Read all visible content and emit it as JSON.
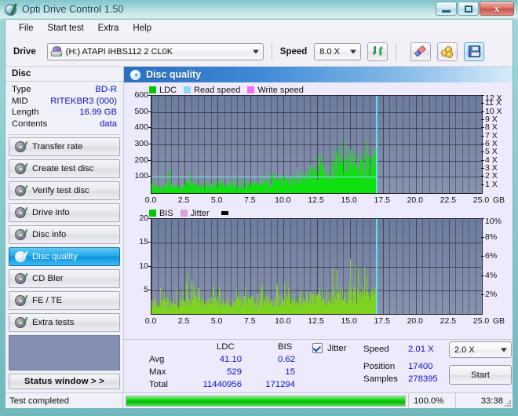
{
  "window": {
    "title": "Opti Drive Control 1.50",
    "icon": "disc-icon",
    "minimize_label": "Minimize",
    "maximize_label": "Maximize",
    "close_label": "Close"
  },
  "menu": {
    "items": [
      "File",
      "Start test",
      "Extra",
      "Help"
    ]
  },
  "toolbar": {
    "drive_label": "Drive",
    "drive_value": "(H:)  ATAPI iHBS112  2 CL0K",
    "drive_icon": "optical-drive-icon",
    "speed_label": "Speed",
    "speed_value": "8.0 X",
    "refresh_icon": "refresh-arrows-icon",
    "erase_icon": "eraser-icon",
    "coins_icon": "coins-icon",
    "save_icon": "save-disk-icon"
  },
  "sidebar": {
    "disc_header": "Disc",
    "disc_info": [
      {
        "key": "Type",
        "value": "BD-R"
      },
      {
        "key": "MID",
        "value": "RITEKBR3 (000)"
      },
      {
        "key": "Length",
        "value": "16.99 GB"
      },
      {
        "key": "Contents",
        "value": "data"
      }
    ],
    "nav": [
      {
        "label": "Transfer rate",
        "icon": "disc-test-icon",
        "selected": false
      },
      {
        "label": "Create test disc",
        "icon": "disc-test-icon",
        "selected": false
      },
      {
        "label": "Verify test disc",
        "icon": "disc-test-icon",
        "selected": false
      },
      {
        "label": "Drive info",
        "icon": "disc-test-icon",
        "selected": false
      },
      {
        "label": "Disc info",
        "icon": "disc-test-icon",
        "selected": false
      },
      {
        "label": "Disc quality",
        "icon": "disc-test-icon",
        "selected": true
      },
      {
        "label": "CD Bler",
        "icon": "disc-test-icon",
        "selected": false
      },
      {
        "label": "FE / TE",
        "icon": "disc-test-icon",
        "selected": false
      },
      {
        "label": "Extra tests",
        "icon": "disc-test-icon",
        "selected": false
      }
    ],
    "status_window_button": "Status window > >"
  },
  "panel": {
    "title": "Disc quality",
    "icon": "disc-quality-icon"
  },
  "chart_data": [
    {
      "type": "area",
      "name": "ldc-chart",
      "title": "",
      "xlabel": "GB",
      "ylabel": "",
      "legend": [
        {
          "label": "LDC",
          "color": "#00c800"
        },
        {
          "label": "Read speed",
          "color": "#8fd8f4"
        },
        {
          "label": "Write speed",
          "color": "#f26ef2"
        }
      ],
      "legend_position": "top-left",
      "grid": true,
      "xlim": [
        0,
        25
      ],
      "xticks": [
        0.0,
        2.5,
        5.0,
        7.5,
        10.0,
        12.5,
        15.0,
        17.5,
        20.0,
        22.5,
        25.0
      ],
      "xtick_labels": [
        "0.0",
        "2.5",
        "5.0",
        "7.5",
        "10.0",
        "12.5",
        "15.0",
        "17.5",
        "20.0",
        "22.5",
        "25.0"
      ],
      "x_unit": "GB",
      "ylim": [
        0,
        600
      ],
      "yticks": [
        100,
        200,
        300,
        400,
        500,
        600
      ],
      "ytick_labels": [
        "100",
        "200",
        "300",
        "400",
        "500",
        "600"
      ],
      "y2lim": [
        0,
        12
      ],
      "y2ticks": [
        1,
        2,
        3,
        4,
        5,
        6,
        7,
        8,
        9,
        10,
        11,
        12
      ],
      "y2tick_labels": [
        "1 X",
        "2 X",
        "3 X",
        "4 X",
        "5 X",
        "6 X",
        "7 X",
        "8 X",
        "9 X",
        "10 X",
        "11 X",
        "12 X"
      ],
      "data_end_x": 17.0,
      "read_speed_level": 2.0,
      "series": [
        {
          "name": "LDC",
          "color": "#0fe00f",
          "x_start": 0,
          "x_end": 17.0,
          "envelope": [
            {
              "x": 0.0,
              "base": 60,
              "peak": 95
            },
            {
              "x": 0.5,
              "base": 58,
              "peak": 100
            },
            {
              "x": 1.0,
              "base": 58,
              "peak": 95
            },
            {
              "x": 1.35,
              "base": 60,
              "peak": 160
            },
            {
              "x": 1.8,
              "base": 57,
              "peak": 92
            },
            {
              "x": 2.4,
              "base": 58,
              "peak": 96
            },
            {
              "x": 2.75,
              "base": 85,
              "peak": 530
            },
            {
              "x": 2.95,
              "base": 70,
              "peak": 205
            },
            {
              "x": 3.3,
              "base": 58,
              "peak": 95
            },
            {
              "x": 4.0,
              "base": 58,
              "peak": 92
            },
            {
              "x": 5.0,
              "base": 58,
              "peak": 95
            },
            {
              "x": 6.0,
              "base": 60,
              "peak": 98
            },
            {
              "x": 7.0,
              "base": 62,
              "peak": 100
            },
            {
              "x": 8.0,
              "base": 70,
              "peak": 108
            },
            {
              "x": 9.0,
              "base": 85,
              "peak": 125
            },
            {
              "x": 10.0,
              "base": 105,
              "peak": 155
            },
            {
              "x": 11.0,
              "base": 120,
              "peak": 175
            },
            {
              "x": 12.0,
              "base": 145,
              "peak": 200
            },
            {
              "x": 12.6,
              "base": 165,
              "peak": 235
            },
            {
              "x": 13.2,
              "base": 200,
              "peak": 270
            },
            {
              "x": 14.0,
              "base": 230,
              "peak": 300
            },
            {
              "x": 14.6,
              "base": 250,
              "peak": 330
            },
            {
              "x": 15.2,
              "base": 255,
              "peak": 345
            },
            {
              "x": 16.0,
              "base": 250,
              "peak": 330
            },
            {
              "x": 16.6,
              "base": 250,
              "peak": 320
            },
            {
              "x": 17.0,
              "base": 255,
              "peak": 350
            }
          ]
        },
        {
          "name": "Read speed",
          "color": "#74e8f0",
          "type": "line",
          "value_x": 2.0,
          "x_start": 0,
          "x_end": 17.0
        }
      ]
    },
    {
      "type": "area",
      "name": "bis-chart",
      "title": "",
      "xlabel": "GB",
      "legend": [
        {
          "label": "BIS",
          "color": "#00c800"
        },
        {
          "label": "Jitter",
          "color": "#dda0dd"
        }
      ],
      "legend_position": "top-left",
      "grid": true,
      "xlim": [
        0,
        25
      ],
      "xticks": [
        0.0,
        2.5,
        5.0,
        7.5,
        10.0,
        12.5,
        15.0,
        17.5,
        20.0,
        22.5,
        25.0
      ],
      "xtick_labels": [
        "0.0",
        "2.5",
        "5.0",
        "7.5",
        "10.0",
        "12.5",
        "15.0",
        "17.5",
        "20.0",
        "22.5",
        "25.0"
      ],
      "x_unit": "GB",
      "ylim": [
        0,
        20
      ],
      "yticks": [
        5,
        10,
        15,
        20
      ],
      "ytick_labels": [
        "5",
        "10",
        "15",
        "20"
      ],
      "y2lim": [
        0,
        10
      ],
      "y2ticks": [
        2,
        4,
        6,
        8,
        10
      ],
      "y2tick_labels": [
        "2%",
        "4%",
        "6%",
        "8%",
        "10%"
      ],
      "data_end_x": 17.0,
      "series": [
        {
          "name": "BIS",
          "color": "#7ed321",
          "x_start": 0,
          "x_end": 17.0,
          "envelope": [
            {
              "x": 0.0,
              "base": 3.3,
              "peak": 4.8
            },
            {
              "x": 0.6,
              "base": 3.4,
              "peak": 5.4
            },
            {
              "x": 1.2,
              "base": 3.4,
              "peak": 5.8
            },
            {
              "x": 1.8,
              "base": 3.3,
              "peak": 5.3
            },
            {
              "x": 2.4,
              "base": 3.4,
              "peak": 5.6
            },
            {
              "x": 2.75,
              "base": 4.2,
              "peak": 11.0
            },
            {
              "x": 3.1,
              "base": 3.5,
              "peak": 6.0
            },
            {
              "x": 4.0,
              "base": 3.4,
              "peak": 5.5
            },
            {
              "x": 5.0,
              "base": 3.5,
              "peak": 6.2
            },
            {
              "x": 6.0,
              "base": 3.6,
              "peak": 6.0
            },
            {
              "x": 7.0,
              "base": 3.8,
              "peak": 6.4
            },
            {
              "x": 8.0,
              "base": 3.9,
              "peak": 6.3
            },
            {
              "x": 9.0,
              "base": 4.0,
              "peak": 6.8
            },
            {
              "x": 10.0,
              "base": 4.2,
              "peak": 7.2
            },
            {
              "x": 10.8,
              "base": 4.3,
              "peak": 7.6
            },
            {
              "x": 11.8,
              "base": 4.6,
              "peak": 13.0
            },
            {
              "x": 12.4,
              "base": 4.8,
              "peak": 8.0
            },
            {
              "x": 13.0,
              "base": 5.4,
              "peak": 9.8
            },
            {
              "x": 13.8,
              "base": 5.6,
              "peak": 10.0
            },
            {
              "x": 14.4,
              "base": 5.6,
              "peak": 9.6
            },
            {
              "x": 15.0,
              "base": 5.8,
              "peak": 12.2
            },
            {
              "x": 15.6,
              "base": 5.8,
              "peak": 10.0
            },
            {
              "x": 16.3,
              "base": 5.7,
              "peak": 10.2
            },
            {
              "x": 17.0,
              "base": 6.0,
              "peak": 15.0
            }
          ]
        }
      ]
    }
  ],
  "stats": {
    "col_headers": [
      "LDC",
      "BIS"
    ],
    "rows": [
      {
        "label": "Avg",
        "ldc": "41.10",
        "bis": "0.62"
      },
      {
        "label": "Max",
        "ldc": "529",
        "bis": "15"
      },
      {
        "label": "Total",
        "ldc": "11440956",
        "bis": "171294"
      }
    ],
    "jitter_checkbox_label": "Jitter",
    "jitter_checked": true,
    "speed_label": "Speed",
    "speed_value": "2.01 X",
    "position_label": "Position",
    "position_value": "17400",
    "samples_label": "Samples",
    "samples_value": "278395",
    "speed_select_value": "2.0 X",
    "start_button": "Start"
  },
  "statusbar": {
    "message": "Test completed",
    "progress_percent": "100.0%",
    "progress_value": 100,
    "elapsed": "33:38"
  }
}
